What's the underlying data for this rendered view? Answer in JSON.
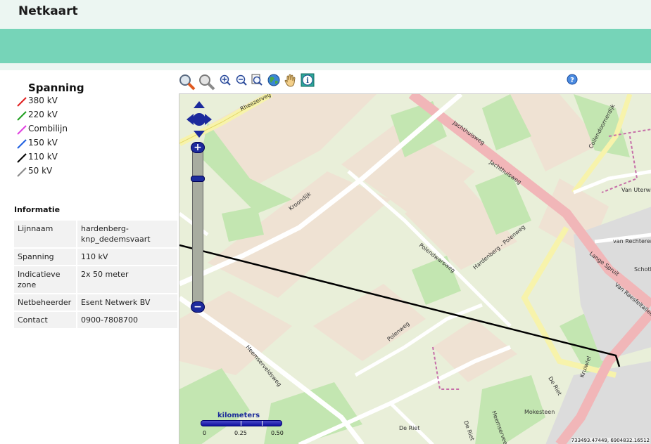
{
  "header": {
    "title": "Netkaart"
  },
  "legend": {
    "heading": "Spanning",
    "items": [
      {
        "label": "380 kV",
        "color": "#e02020"
      },
      {
        "label": "220 kV",
        "color": "#20a020"
      },
      {
        "label": "Combilijn",
        "color": "#e040e0"
      },
      {
        "label": "150 kV",
        "color": "#2060e0"
      },
      {
        "label": "110 kV",
        "color": "#000000"
      },
      {
        "label": "50 kV",
        "color": "#888888"
      }
    ]
  },
  "info": {
    "heading": "Informatie",
    "rows": [
      {
        "key": "Lijnnaam",
        "value": "hardenberg-knp_dedemsvaart"
      },
      {
        "key": "Spanning",
        "value": "110 kV"
      },
      {
        "key": "Indicatieve zone",
        "value": "2x 50 meter"
      },
      {
        "key": "Netbeheerder",
        "value": "Esent Netwerk BV"
      },
      {
        "key": "Contact",
        "value": "0900-7808700"
      }
    ]
  },
  "toolbar": {
    "tools": [
      {
        "name": "zoom-in-box-icon"
      },
      {
        "name": "zoom-out-box-icon"
      },
      {
        "name": "zoom-in-icon"
      },
      {
        "name": "zoom-out-icon"
      },
      {
        "name": "zoom-extent-icon"
      },
      {
        "name": "globe-icon"
      },
      {
        "name": "pan-hand-icon"
      },
      {
        "name": "info-icon"
      },
      {
        "name": "help-icon"
      }
    ]
  },
  "map": {
    "coordinates": "733493.47449, 6904832.16512",
    "scale": {
      "unit": "kilometers",
      "ticks": [
        "0",
        "0.25",
        "0.50"
      ]
    },
    "streets": [
      "Rheezerveg",
      "Kroondijk",
      "Jachthuisweg",
      "Jachthuisweg",
      "Collendoornerdijk",
      "Van Uterwijk",
      "van Rechteren",
      "Lange Spruit",
      "Van Raesfeltallee",
      "Schotl",
      "Polendwarsweg",
      "Hardenberg - Polenweg",
      "Heemserveldsweg",
      "Polenweg",
      "De Riet",
      "Kruiwiel",
      "Mokesteen",
      "Heemserveen",
      "De Riet",
      "De Riet"
    ],
    "colors": {
      "land": "#e9efd9",
      "field": "#efe2d3",
      "forest": "#c3e6b1",
      "road_main": "#f1b6b8",
      "road_yellow": "#f7f3ab",
      "road_white": "#ffffff",
      "line_110kv": "#000000"
    }
  }
}
